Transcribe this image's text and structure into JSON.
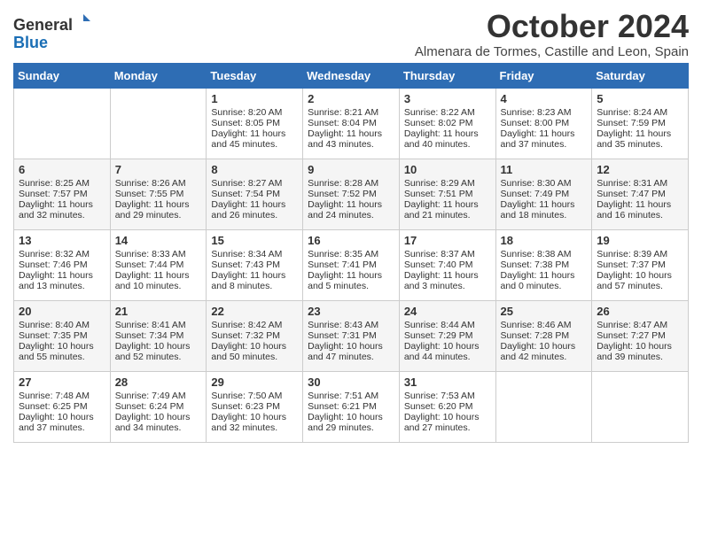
{
  "logo": {
    "general": "General",
    "blue": "Blue"
  },
  "title": "October 2024",
  "subtitle": "Almenara de Tormes, Castille and Leon, Spain",
  "days_of_week": [
    "Sunday",
    "Monday",
    "Tuesday",
    "Wednesday",
    "Thursday",
    "Friday",
    "Saturday"
  ],
  "weeks": [
    [
      {
        "day": "",
        "info": ""
      },
      {
        "day": "",
        "info": ""
      },
      {
        "day": "1",
        "info": "Sunrise: 8:20 AM\nSunset: 8:05 PM\nDaylight: 11 hours and 45 minutes."
      },
      {
        "day": "2",
        "info": "Sunrise: 8:21 AM\nSunset: 8:04 PM\nDaylight: 11 hours and 43 minutes."
      },
      {
        "day": "3",
        "info": "Sunrise: 8:22 AM\nSunset: 8:02 PM\nDaylight: 11 hours and 40 minutes."
      },
      {
        "day": "4",
        "info": "Sunrise: 8:23 AM\nSunset: 8:00 PM\nDaylight: 11 hours and 37 minutes."
      },
      {
        "day": "5",
        "info": "Sunrise: 8:24 AM\nSunset: 7:59 PM\nDaylight: 11 hours and 35 minutes."
      }
    ],
    [
      {
        "day": "6",
        "info": "Sunrise: 8:25 AM\nSunset: 7:57 PM\nDaylight: 11 hours and 32 minutes."
      },
      {
        "day": "7",
        "info": "Sunrise: 8:26 AM\nSunset: 7:55 PM\nDaylight: 11 hours and 29 minutes."
      },
      {
        "day": "8",
        "info": "Sunrise: 8:27 AM\nSunset: 7:54 PM\nDaylight: 11 hours and 26 minutes."
      },
      {
        "day": "9",
        "info": "Sunrise: 8:28 AM\nSunset: 7:52 PM\nDaylight: 11 hours and 24 minutes."
      },
      {
        "day": "10",
        "info": "Sunrise: 8:29 AM\nSunset: 7:51 PM\nDaylight: 11 hours and 21 minutes."
      },
      {
        "day": "11",
        "info": "Sunrise: 8:30 AM\nSunset: 7:49 PM\nDaylight: 11 hours and 18 minutes."
      },
      {
        "day": "12",
        "info": "Sunrise: 8:31 AM\nSunset: 7:47 PM\nDaylight: 11 hours and 16 minutes."
      }
    ],
    [
      {
        "day": "13",
        "info": "Sunrise: 8:32 AM\nSunset: 7:46 PM\nDaylight: 11 hours and 13 minutes."
      },
      {
        "day": "14",
        "info": "Sunrise: 8:33 AM\nSunset: 7:44 PM\nDaylight: 11 hours and 10 minutes."
      },
      {
        "day": "15",
        "info": "Sunrise: 8:34 AM\nSunset: 7:43 PM\nDaylight: 11 hours and 8 minutes."
      },
      {
        "day": "16",
        "info": "Sunrise: 8:35 AM\nSunset: 7:41 PM\nDaylight: 11 hours and 5 minutes."
      },
      {
        "day": "17",
        "info": "Sunrise: 8:37 AM\nSunset: 7:40 PM\nDaylight: 11 hours and 3 minutes."
      },
      {
        "day": "18",
        "info": "Sunrise: 8:38 AM\nSunset: 7:38 PM\nDaylight: 11 hours and 0 minutes."
      },
      {
        "day": "19",
        "info": "Sunrise: 8:39 AM\nSunset: 7:37 PM\nDaylight: 10 hours and 57 minutes."
      }
    ],
    [
      {
        "day": "20",
        "info": "Sunrise: 8:40 AM\nSunset: 7:35 PM\nDaylight: 10 hours and 55 minutes."
      },
      {
        "day": "21",
        "info": "Sunrise: 8:41 AM\nSunset: 7:34 PM\nDaylight: 10 hours and 52 minutes."
      },
      {
        "day": "22",
        "info": "Sunrise: 8:42 AM\nSunset: 7:32 PM\nDaylight: 10 hours and 50 minutes."
      },
      {
        "day": "23",
        "info": "Sunrise: 8:43 AM\nSunset: 7:31 PM\nDaylight: 10 hours and 47 minutes."
      },
      {
        "day": "24",
        "info": "Sunrise: 8:44 AM\nSunset: 7:29 PM\nDaylight: 10 hours and 44 minutes."
      },
      {
        "day": "25",
        "info": "Sunrise: 8:46 AM\nSunset: 7:28 PM\nDaylight: 10 hours and 42 minutes."
      },
      {
        "day": "26",
        "info": "Sunrise: 8:47 AM\nSunset: 7:27 PM\nDaylight: 10 hours and 39 minutes."
      }
    ],
    [
      {
        "day": "27",
        "info": "Sunrise: 7:48 AM\nSunset: 6:25 PM\nDaylight: 10 hours and 37 minutes."
      },
      {
        "day": "28",
        "info": "Sunrise: 7:49 AM\nSunset: 6:24 PM\nDaylight: 10 hours and 34 minutes."
      },
      {
        "day": "29",
        "info": "Sunrise: 7:50 AM\nSunset: 6:23 PM\nDaylight: 10 hours and 32 minutes."
      },
      {
        "day": "30",
        "info": "Sunrise: 7:51 AM\nSunset: 6:21 PM\nDaylight: 10 hours and 29 minutes."
      },
      {
        "day": "31",
        "info": "Sunrise: 7:53 AM\nSunset: 6:20 PM\nDaylight: 10 hours and 27 minutes."
      },
      {
        "day": "",
        "info": ""
      },
      {
        "day": "",
        "info": ""
      }
    ]
  ]
}
